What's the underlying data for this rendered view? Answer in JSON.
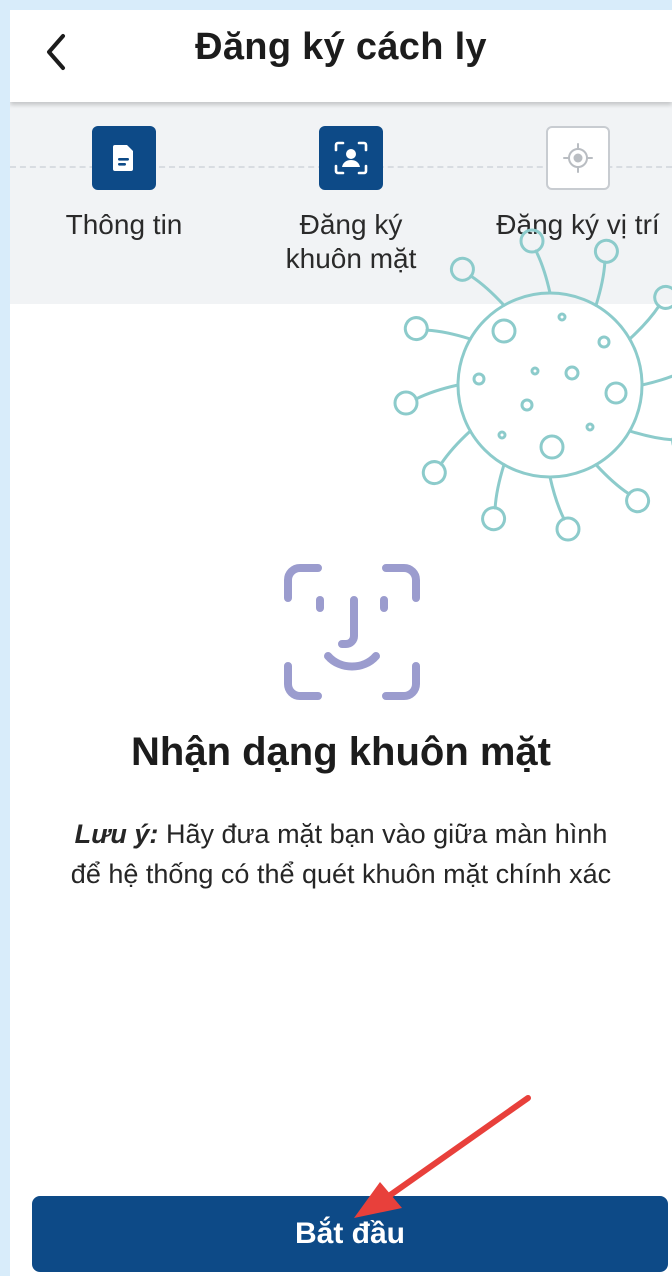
{
  "header": {
    "title": "Đăng ký cách ly",
    "back_icon": "chevron-left-icon"
  },
  "steps": [
    {
      "label": "Thông tin",
      "icon": "document-icon",
      "state": "done"
    },
    {
      "label": "Đăng ký\nkhuôn mặt",
      "icon": "face-id-icon",
      "state": "active"
    },
    {
      "label": "Đăng ký vị trí",
      "icon": "location-target-icon",
      "state": "inactive"
    }
  ],
  "main": {
    "icon": "face-scan-icon",
    "heading": "Nhận dạng khuôn mặt",
    "note_lead": "Lưu ý:",
    "note_text": " Hãy đưa mặt bạn vào giữa màn hình để hệ thống có thể quét khuôn mặt chính xác"
  },
  "footer": {
    "start_label": "Bắt đầu"
  },
  "colors": {
    "primary": "#0d4a87",
    "face_icon": "#9b9cce",
    "virus_outline": "#8ccbcb",
    "annotation_arrow": "#e8403b",
    "outer_background": "#d8ecfa"
  }
}
